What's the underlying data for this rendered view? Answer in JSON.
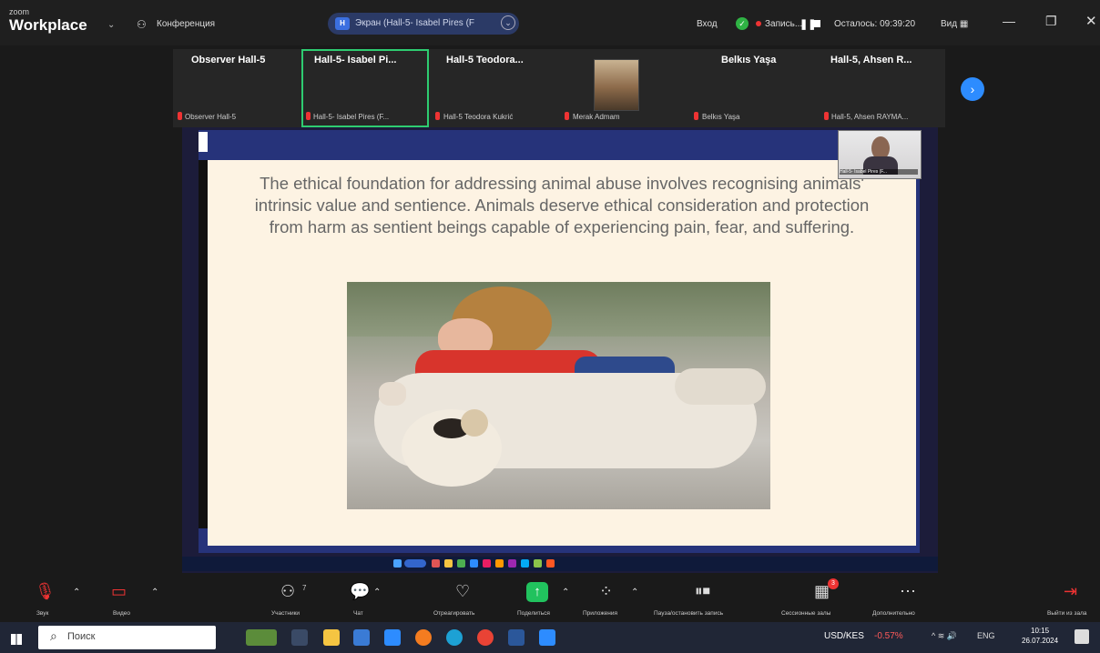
{
  "titlebar": {
    "logo_small": "zoom",
    "logo_big": "Workplace",
    "conference_label": "Конференция",
    "share_badge": "H",
    "share_text": "Экран (Hall-5- Isabel Pires (F",
    "enter_label": "Вход",
    "recording_label": "Запись...",
    "remaining_label": "Осталось: 09:39:20",
    "view_label": "Вид"
  },
  "participants": [
    {
      "name": "Observer Hall-5",
      "sub": "Observer Hall-5"
    },
    {
      "name": "Hall-5- Isabel Pi...",
      "sub": "Hall-5- Isabel Pires (F..."
    },
    {
      "name": "Hall-5  Teodora...",
      "sub": "Hall-5 Teodora Kukrić"
    },
    {
      "name": "",
      "sub": "Merak Admam"
    },
    {
      "name": "Belkıs Yaşa",
      "sub": "Belkıs Yaşa"
    },
    {
      "name": "Hall-5, Ahsen R...",
      "sub": "Hall-5, Ahsen RAYMA..."
    }
  ],
  "slide": {
    "text": "The ethical foundation for addressing animal abuse involves recognising animals' intrinsic value and sentience. Animals deserve ethical consideration and protection from harm as sentient beings capable of experiencing pain, fear, and suffering."
  },
  "controls": {
    "audio": "Звук",
    "video": "Видео",
    "participants": "Участники",
    "participants_count": "7",
    "chat": "Чат",
    "react": "Отреагировать",
    "share": "Поделиться",
    "apps": "Приложения",
    "pause_rec": "Пауза/остановить запись",
    "breakout": "Сессионные залы",
    "breakout_badge": "3",
    "more": "Дополнительно",
    "leave": "Выйти из зала"
  },
  "taskbar": {
    "search_placeholder": "Поиск",
    "rate_label": "USD/KES",
    "rate_change": "-0.57%",
    "lang": "ENG",
    "time": "10:15",
    "date": "26.07.2024"
  }
}
